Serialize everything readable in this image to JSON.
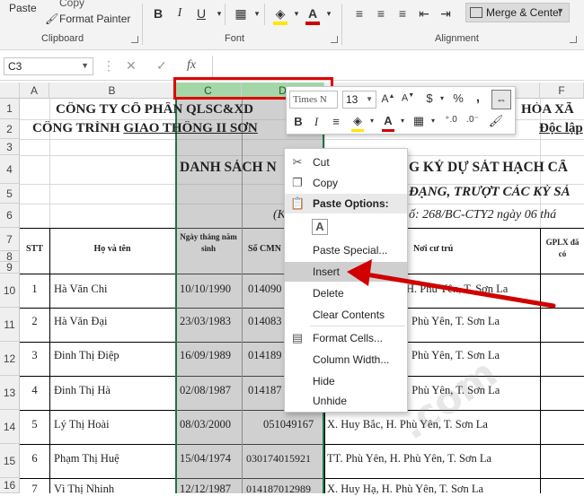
{
  "ribbon": {
    "paste_label": "Paste",
    "copy_label": "Copy",
    "format_painter_label": "Format Painter",
    "clipboard_group": "Clipboard",
    "font_group": "Font",
    "alignment_group": "Alignment",
    "merge_center_label": "Merge & Center",
    "bold": "B",
    "italic": "I",
    "underline": "U",
    "font_color_letter": "A"
  },
  "formula_bar": {
    "name_box": "C3",
    "fx": "fx"
  },
  "columns": [
    "A",
    "B",
    "C",
    "D",
    "F"
  ],
  "rows": [
    "1",
    "2",
    "3",
    "4",
    "5",
    "6",
    "7",
    "8",
    "9",
    "10",
    "11",
    "12",
    "13",
    "14",
    "15",
    "16"
  ],
  "sheet": {
    "line1": "CÔNG TY CỔ PHẦN QLSC&XD",
    "line1_right": "HÒA XÃ",
    "line2_prefix": "CÔNG TRÌNH ",
    "line2_underlined": "GIAO THÔNG II SƠN",
    "line2_right": "Độc lập",
    "title": "DANH SÁCH N",
    "title_right": "G KÝ DỰ SÁT HẠCH CẤ",
    "subtitle_right": "ĐẠNG, TRƯỢT CÁC KỲ SÁ",
    "ref_left": "(K",
    "ref_right": "ố: 268/BC-CTY2 ngày 06 thá",
    "headers": {
      "stt": "STT",
      "name": "Họ và tên",
      "dob": "Ngày tháng năm sinh",
      "cmnd": "Số CMN",
      "address": "Nơi cư trú",
      "gplx": "GPLX đã có"
    },
    "records": [
      {
        "stt": "1",
        "name": "Hà Văn Chi",
        "dob": "10/10/1990",
        "cmnd": "014090",
        "address": "H. Phù Yên, T. Sơn La"
      },
      {
        "stt": "2",
        "name": "Hà Văn Đại",
        "dob": "23/03/1983",
        "cmnd": "014083",
        "address": "Phù Yên, T. Sơn La"
      },
      {
        "stt": "3",
        "name": "Đinh Thị Điệp",
        "dob": "16/09/1989",
        "cmnd": "014189",
        "address": "Phù Yên, T. Sơn La"
      },
      {
        "stt": "4",
        "name": "Đinh Thị Hà",
        "dob": "02/08/1987",
        "cmnd": "014187",
        "address": ". Phù Yên, T. Sơn La"
      },
      {
        "stt": "5",
        "name": "Lý Thị Hoài",
        "dob": "08/03/2000",
        "cmnd": "051049167",
        "address": "X. Huy Bắc, H. Phù Yên, T. Sơn La"
      },
      {
        "stt": "6",
        "name": "Phạm Thị Huệ",
        "dob": "15/04/1974",
        "cmnd": "030174015921",
        "address": "TT. Phù Yên, H. Phù Yên, T. Sơn La"
      },
      {
        "stt": "7",
        "name": "Vì Thị Nhinh",
        "dob": "12/12/1987",
        "cmnd": "014187012989",
        "address": "X. Huy Hạ, H. Phù Yên, T. Sơn La"
      }
    ]
  },
  "mini_toolbar": {
    "font_name": "Times N",
    "font_size": "13",
    "bold": "B",
    "italic": "I",
    "currency": "$",
    "percent": "%",
    "comma": ","
  },
  "context_menu": {
    "items": [
      {
        "label": "Cut",
        "icon": "scissors-icon"
      },
      {
        "label": "Copy",
        "icon": "copy-icon"
      },
      {
        "label": "Paste Options:",
        "icon": "clipboard-icon"
      },
      {
        "label": "",
        "icon": "paste-a-icon"
      },
      {
        "label": "Paste Special...",
        "icon": ""
      },
      {
        "label": "Insert",
        "icon": ""
      },
      {
        "label": "Delete",
        "icon": ""
      },
      {
        "label": "Clear Contents",
        "icon": ""
      },
      {
        "label": "Format Cells...",
        "icon": "format-cells-icon"
      },
      {
        "label": "Column Width...",
        "icon": ""
      },
      {
        "label": "Hide",
        "icon": ""
      },
      {
        "label": "Unhide",
        "icon": ""
      }
    ]
  },
  "colors": {
    "selection_green": "#217346",
    "highlight_red": "#e00000",
    "font_color_red": "#d00000",
    "fill_yellow": "#ffe600"
  }
}
